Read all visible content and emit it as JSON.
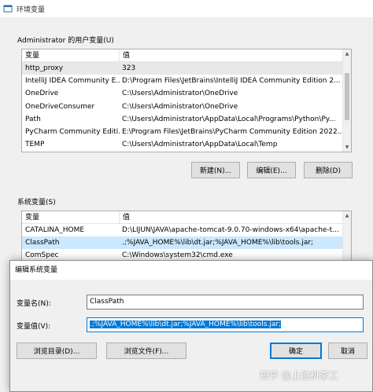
{
  "window": {
    "title": "环境变量"
  },
  "user_vars": {
    "group_label": "Administrator 的用户变量(U)",
    "columns": [
      "变量",
      "值"
    ],
    "rows": [
      {
        "name": "http_proxy",
        "value": "323"
      },
      {
        "name": "IntelliJ IDEA Community E...",
        "value": "D:\\Program Files\\JetBrains\\IntelliJ IDEA Community Edition 2..."
      },
      {
        "name": "OneDrive",
        "value": "C:\\Users\\Administrator\\OneDrive"
      },
      {
        "name": "OneDriveConsumer",
        "value": "C:\\Users\\Administrator\\OneDrive"
      },
      {
        "name": "Path",
        "value": "C:\\Users\\Administrator\\AppData\\Local\\Programs\\Python\\Py..."
      },
      {
        "name": "PyCharm Community Editi...",
        "value": "E:\\Program Files\\JetBrains\\PyCharm Community Edition 2022...."
      },
      {
        "name": "TEMP",
        "value": "C:\\Users\\Administrator\\AppData\\Local\\Temp"
      }
    ],
    "buttons": {
      "new": "新建(N)...",
      "edit": "编辑(E)...",
      "delete": "删除(D)"
    }
  },
  "system_vars": {
    "group_label": "系统变量(S)",
    "columns": [
      "变量",
      "值"
    ],
    "rows": [
      {
        "name": "CATALINA_HOME",
        "value": "D:\\LIJUN\\JAVA\\apache-tomcat-9.0.70-windows-x64\\apache-t..."
      },
      {
        "name": "ClassPath",
        "value": ".;%JAVA_HOME%\\lib\\dt.jar;%JAVA_HOME%\\lib\\tools.jar;"
      },
      {
        "name": "ComSpec",
        "value": "C:\\Windows\\system32\\cmd.exe"
      }
    ]
  },
  "edit_dialog": {
    "title": "编辑系统变量",
    "name_label": "变量名(N):",
    "name_value": "ClassPath",
    "value_label": "变量值(V):",
    "value_value": ".;%JAVA_HOME%\\lib\\dt.jar;%JAVA_HOME%\\lib\\tools.jar;",
    "browse_dir": "浏览目录(D)...",
    "browse_file": "浏览文件(F)...",
    "ok": "确定",
    "cancel": "取消"
  },
  "watermark": "知乎 @上位机李工",
  "colors": {
    "accent": "#0078d7",
    "selection": "#cce8ff"
  }
}
